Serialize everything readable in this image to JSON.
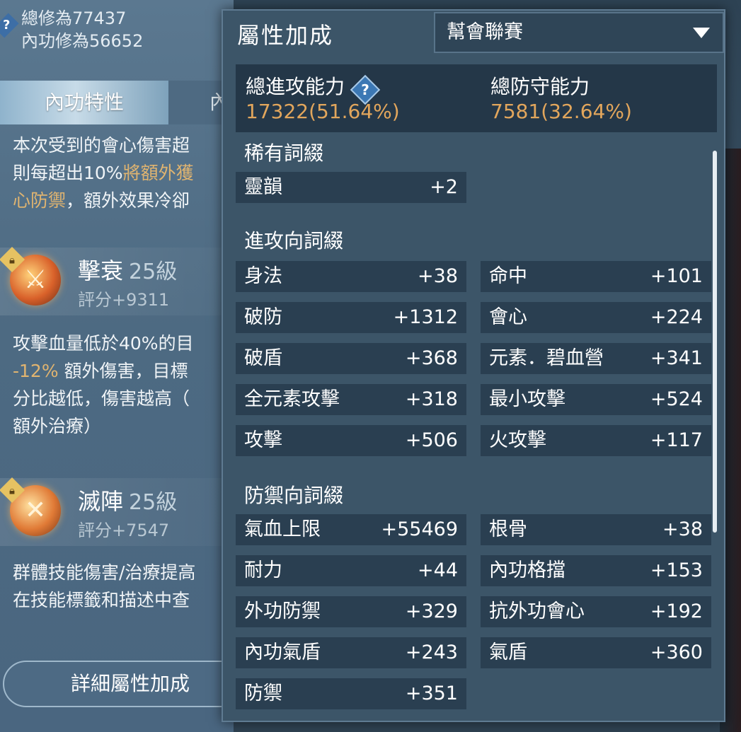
{
  "header": {
    "help_glyph": "?",
    "total_cultivation": "總修為77437",
    "internal_cultivation": "內功修為56652"
  },
  "tabs": {
    "active": "內功特性",
    "inactive": "內"
  },
  "description_1": {
    "line1": "本次受到的會心傷害超",
    "line2_plain": "則每超出10%",
    "line2_gold": "將額外獲",
    "line3_gold": "心防禦",
    "line3_plain": "，額外效果冷卻"
  },
  "skills": [
    {
      "name": "擊衰",
      "level": "25級",
      "score": "評分+9311",
      "icon": "flame-sword-icon"
    },
    {
      "name": "滅陣",
      "level": "25級",
      "score": "評分+7547",
      "icon": "crossed-swords-icon"
    }
  ],
  "description_2": {
    "line1": "攻擊血量低於40%的目",
    "line2_gold": "-12%",
    "line2_plain": " 額外傷害，目標",
    "line3": "分比越低，傷害越高（",
    "line4": "額外治療）"
  },
  "description_3": {
    "line1": "群體技能傷害/治療提高",
    "line2": "在技能標籤和描述中查"
  },
  "detail_button": "詳細屬性加成",
  "popup": {
    "title": "屬性加成",
    "dropdown_value": "幫會聯賽",
    "attack_label": "總進攻能力",
    "attack_value": "17322(51.64%)",
    "defense_label": "總防守能力",
    "defense_value": "7581(32.64%)",
    "rare_section": "稀有詞綴",
    "rare": [
      {
        "label": "靈韻",
        "value": "+2"
      }
    ],
    "offense_section": "進攻向詞綴",
    "offense": [
      {
        "label": "身法",
        "value": "+38"
      },
      {
        "label": "命中",
        "value": "+101"
      },
      {
        "label": "破防",
        "value": "+1312"
      },
      {
        "label": "會心",
        "value": "+224"
      },
      {
        "label": "破盾",
        "value": "+368"
      },
      {
        "label": "元素．碧血營",
        "value": "+341"
      },
      {
        "label": "全元素攻擊",
        "value": "+318"
      },
      {
        "label": "最小攻擊",
        "value": "+524"
      },
      {
        "label": "攻擊",
        "value": "+506"
      },
      {
        "label": "火攻擊",
        "value": "+117"
      }
    ],
    "defense_section": "防禦向詞綴",
    "defense": [
      {
        "label": "氣血上限",
        "value": "+55469"
      },
      {
        "label": "根骨",
        "value": "+38"
      },
      {
        "label": "耐力",
        "value": "+44"
      },
      {
        "label": "內功格擋",
        "value": "+153"
      },
      {
        "label": "外功防禦",
        "value": "+329"
      },
      {
        "label": "抗外功會心",
        "value": "+192"
      },
      {
        "label": "內功氣盾",
        "value": "+243"
      },
      {
        "label": "氣盾",
        "value": "+360"
      },
      {
        "label": "防禦",
        "value": "+351"
      }
    ]
  },
  "colors": {
    "gold": "#e2a65c",
    "panel": "#3c5568",
    "cell": "#2a3f51"
  }
}
